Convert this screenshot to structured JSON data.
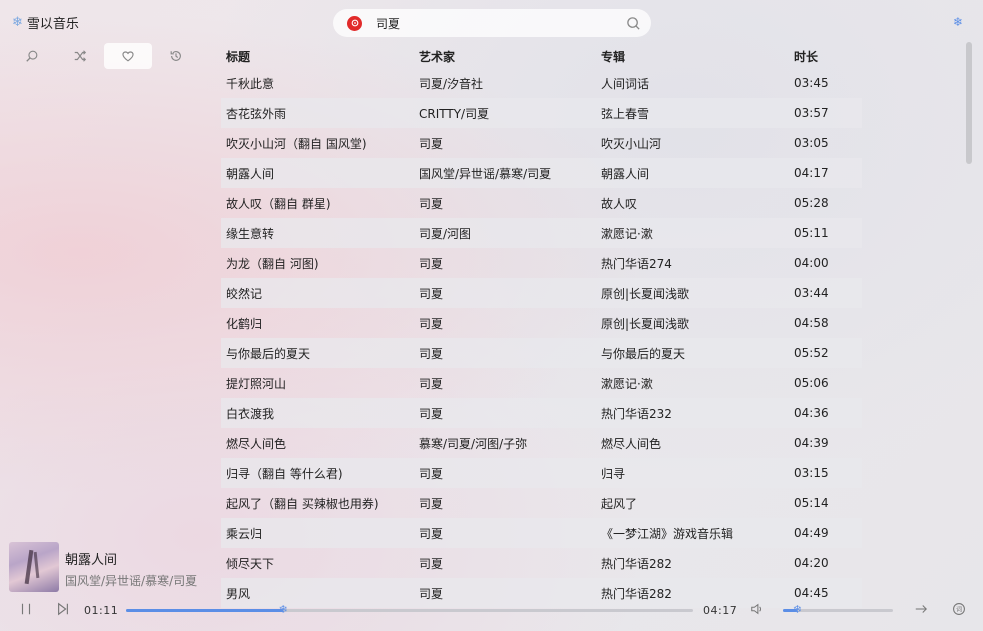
{
  "app": {
    "name": "雪以音乐"
  },
  "search": {
    "value": "司夏"
  },
  "table": {
    "headers": [
      "标题",
      "艺术家",
      "专辑",
      "时长"
    ],
    "rows": [
      [
        "千秋此意",
        "司夏/汐音社",
        "人间词话",
        "03:45"
      ],
      [
        "杏花弦外雨",
        "CRITTY/司夏",
        "弦上春雪",
        "03:57"
      ],
      [
        "吹灭小山河（翻自 国风堂)",
        "司夏",
        "吹灭小山河",
        "03:05"
      ],
      [
        "朝露人间",
        "国风堂/异世谣/慕寒/司夏",
        "朝露人间",
        "04:17"
      ],
      [
        "故人叹（翻自 群星)",
        "司夏",
        "故人叹",
        "05:28"
      ],
      [
        "缘生意转",
        "司夏/河图",
        "漱愿记·漱",
        "05:11"
      ],
      [
        "为龙（翻自 河图)",
        "司夏",
        "热门华语274",
        "04:00"
      ],
      [
        "皎然记",
        "司夏",
        "原创|长夏闻浅歌",
        "03:44"
      ],
      [
        "化鹤归",
        "司夏",
        "原创|长夏闻浅歌",
        "04:58"
      ],
      [
        "与你最后的夏天",
        "司夏",
        "与你最后的夏天",
        "05:52"
      ],
      [
        "提灯照河山",
        "司夏",
        "漱愿记·漱",
        "05:06"
      ],
      [
        "白衣渡我",
        "司夏",
        "热门华语232",
        "04:36"
      ],
      [
        "燃尽人间色",
        "慕寒/司夏/河图/子弥",
        "燃尽人间色",
        "04:39"
      ],
      [
        "归寻（翻自 等什么君)",
        "司夏",
        "归寻",
        "03:15"
      ],
      [
        "起风了（翻自 买辣椒也用券)",
        "司夏",
        "起风了",
        "05:14"
      ],
      [
        "乘云归",
        "司夏",
        "《一梦江湖》游戏音乐辑",
        "04:49"
      ],
      [
        "倾尽天下",
        "司夏",
        "热门华语282",
        "04:20"
      ],
      [
        "男风",
        "司夏",
        "热门华语282",
        "04:45"
      ]
    ]
  },
  "player": {
    "title": "朝露人间",
    "artist": "国风堂/异世谣/慕寒/司夏",
    "elapsed": "01:11",
    "duration": "04:17",
    "progress": 0.277,
    "volume": 0.13
  },
  "colors": {
    "accent": "#5b8ee6",
    "netease_red": "#e12a2a"
  }
}
